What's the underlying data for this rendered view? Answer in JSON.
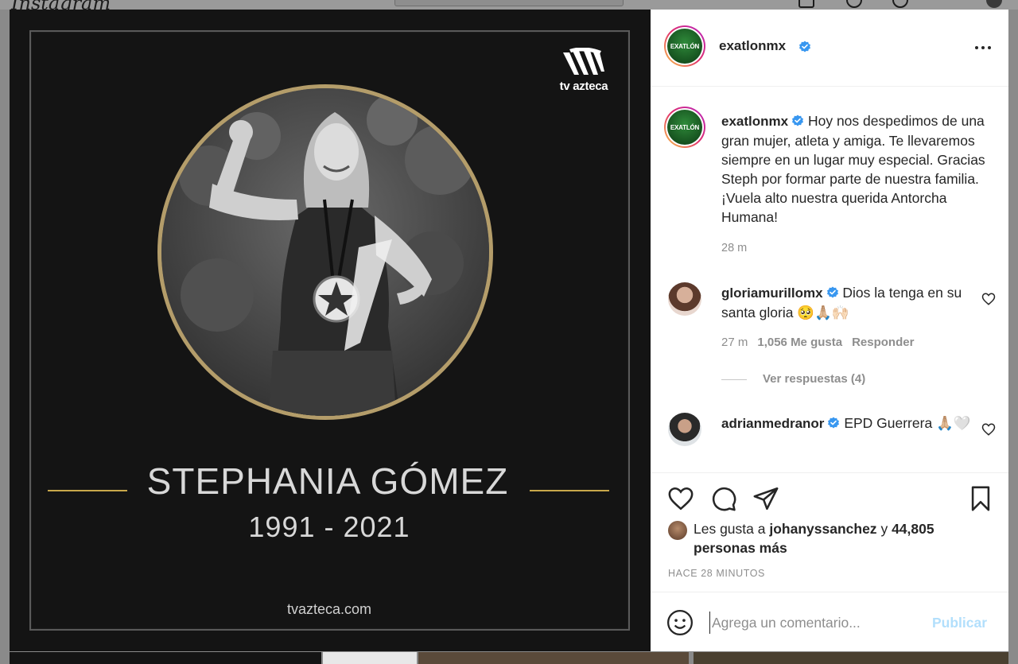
{
  "background_page": {
    "logo": "Instagram"
  },
  "post_image": {
    "brand": "tv azteca",
    "name": "STEPHANIA GÓMEZ",
    "years": "1991 - 2021",
    "website": "tvazteca.com",
    "accent_color": "#c9a84a"
  },
  "header": {
    "username": "exatlonmx",
    "avatar_text": "EXATLÓN"
  },
  "caption": {
    "username": "exatlonmx",
    "text": "Hoy nos despedimos de una gran mujer, atleta y amiga. Te llevaremos siempre en un lugar muy especial. Gracias Steph por formar parte de nuestra familia. ¡Vuela alto nuestra querida Antorcha Humana!",
    "time": "28 m"
  },
  "comments": [
    {
      "username": "gloriamurillomx",
      "text": "Dios la tenga en su santa gloria 🥺🙏🏼🙌🏻",
      "time": "27 m",
      "likes": "1,056 Me gusta",
      "reply_label": "Responder",
      "view_replies": "Ver respuestas (4)"
    },
    {
      "username": "adrianmedranor",
      "text": "EPD Guerrera 🙏🏼🤍"
    }
  ],
  "likes": {
    "prefix": "Les gusta a",
    "user": "johanyssanchez",
    "conjunction": "y",
    "others": "44,805 personas más"
  },
  "timestamp": "HACE 28 MINUTOS",
  "comment_box": {
    "placeholder": "Agrega un comentario...",
    "publish_label": "Publicar"
  },
  "colors": {
    "verified": "#3897f0",
    "publish_disabled": "#b2dffc",
    "muted": "#8e8e8e"
  }
}
